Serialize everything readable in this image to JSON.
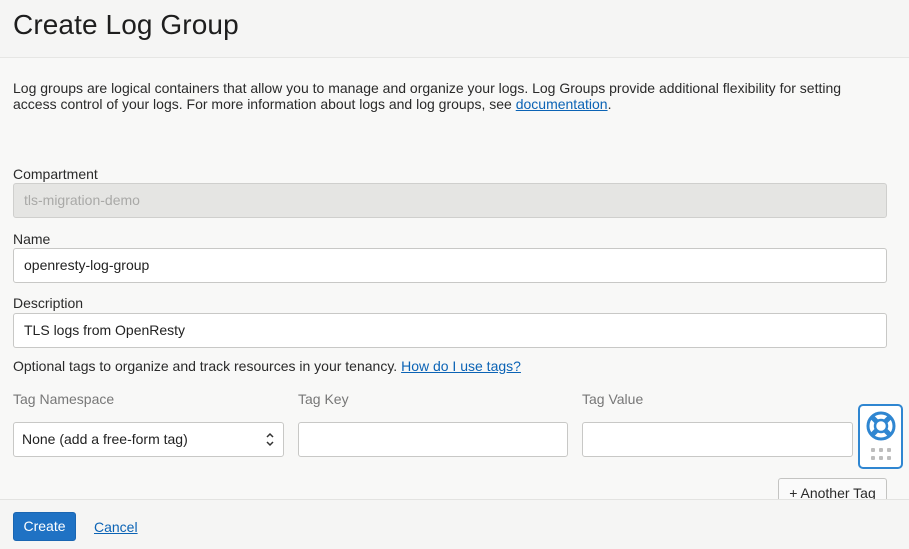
{
  "page": {
    "title": "Create Log Group"
  },
  "intro": {
    "text": "Log groups are logical containers that allow you to manage and organize your logs. Log Groups provide additional flexibility for setting access control of your logs. For more information about logs and log groups, see ",
    "link_label": "documentation",
    "suffix": "."
  },
  "form": {
    "compartment": {
      "label": "Compartment",
      "value": "tls-migration-demo"
    },
    "name": {
      "label": "Name",
      "value": "openresty-log-group"
    },
    "description": {
      "label": "Description",
      "value": "TLS logs from OpenResty"
    }
  },
  "tags": {
    "note": "Optional tags to organize and track resources in your tenancy.",
    "help_link": "How do I use tags?",
    "namespace_label": "Tag Namespace",
    "key_label": "Tag Key",
    "value_label": "Tag Value",
    "namespace_selected": "None (add a free-form tag)",
    "key_value": "",
    "value_value": "",
    "another_tag_label": "+ Another Tag"
  },
  "footer": {
    "create_label": "Create",
    "cancel_label": "Cancel"
  },
  "colors": {
    "accent": "#1f72c4",
    "link": "#0b63b5",
    "help_border": "#2f86d1"
  },
  "icons": {
    "help": "lifebuoy-icon",
    "grip": "drag-handle-icon",
    "select": "chevron-up-down-icon"
  }
}
